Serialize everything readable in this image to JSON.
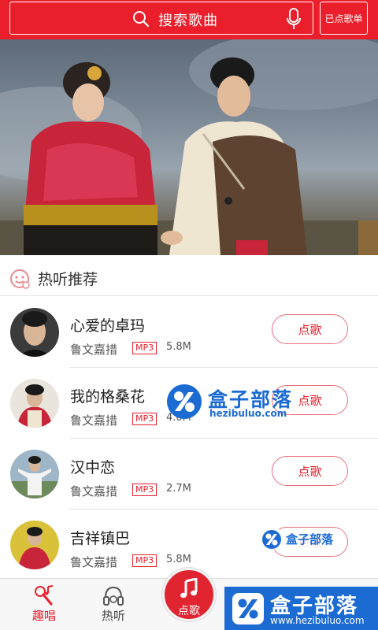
{
  "header": {
    "search_placeholder": "搜索歌曲",
    "queue_button": "已点歌单"
  },
  "banner": {
    "slide_count": 10,
    "active_index": 0
  },
  "section": {
    "title": "热听推荐"
  },
  "songs": [
    {
      "title": "心爱的卓玛",
      "artist": "鲁文嘉措",
      "format": "MP3",
      "size": "5.8M",
      "button": "点歌"
    },
    {
      "title": "我的格桑花",
      "artist": "鲁文嘉措",
      "format": "MP3",
      "size": "4.0M",
      "button": "点歌"
    },
    {
      "title": "汉中恋",
      "artist": "鲁文嘉措",
      "format": "MP3",
      "size": "2.7M",
      "button": "点歌"
    },
    {
      "title": "吉祥镇巴",
      "artist": "鲁文嘉措",
      "format": "MP3",
      "size": "5.8M",
      "button": "点歌"
    }
  ],
  "watermark": {
    "brand": "盒子部落",
    "url": "hezibuluo.com",
    "url_full": "www.hezibuluo.com"
  },
  "tabbar": {
    "tabs": [
      {
        "label": "趣唱"
      },
      {
        "label": "热听"
      },
      {
        "label": "点歌"
      }
    ]
  },
  "colors": {
    "accent": "#ea1f2b",
    "watermark_blue": "#1b6bd3"
  }
}
